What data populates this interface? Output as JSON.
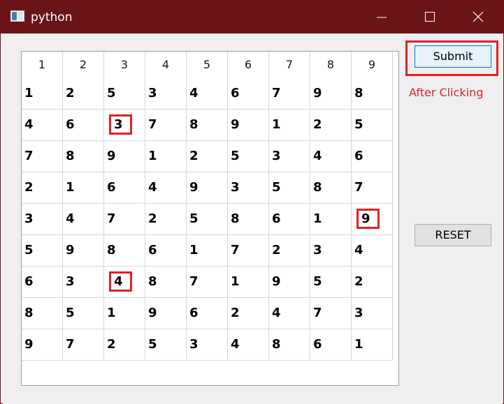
{
  "window": {
    "title": "python",
    "titlebar_color": "#6a1418"
  },
  "controls": {
    "minimize_icon": "minimize-icon",
    "maximize_icon": "maximize-icon",
    "close_icon": "close-icon"
  },
  "table": {
    "headers": [
      "1",
      "2",
      "3",
      "4",
      "5",
      "6",
      "7",
      "8",
      "9"
    ],
    "rows": [
      [
        "1",
        "2",
        "5",
        "3",
        "4",
        "6",
        "7",
        "9",
        "8"
      ],
      [
        "4",
        "6",
        "3",
        "7",
        "8",
        "9",
        "1",
        "2",
        "5"
      ],
      [
        "7",
        "8",
        "9",
        "1",
        "2",
        "5",
        "3",
        "4",
        "6"
      ],
      [
        "2",
        "1",
        "6",
        "4",
        "9",
        "3",
        "5",
        "8",
        "7"
      ],
      [
        "3",
        "4",
        "7",
        "2",
        "5",
        "8",
        "6",
        "1",
        "9"
      ],
      [
        "5",
        "9",
        "8",
        "6",
        "1",
        "7",
        "2",
        "3",
        "4"
      ],
      [
        "6",
        "3",
        "4",
        "8",
        "7",
        "1",
        "9",
        "5",
        "2"
      ],
      [
        "8",
        "5",
        "1",
        "9",
        "6",
        "2",
        "4",
        "7",
        "3"
      ],
      [
        "9",
        "7",
        "2",
        "5",
        "3",
        "4",
        "8",
        "6",
        "1"
      ]
    ],
    "highlighted_cells": [
      [
        1,
        2
      ],
      [
        4,
        8
      ],
      [
        6,
        2
      ]
    ],
    "highlight_color": "#e0202a"
  },
  "buttons": {
    "submit_label": "Submit",
    "reset_label": "RESET"
  },
  "annotation": {
    "after_clicking": "After Clicking",
    "color": "#e0202a"
  }
}
